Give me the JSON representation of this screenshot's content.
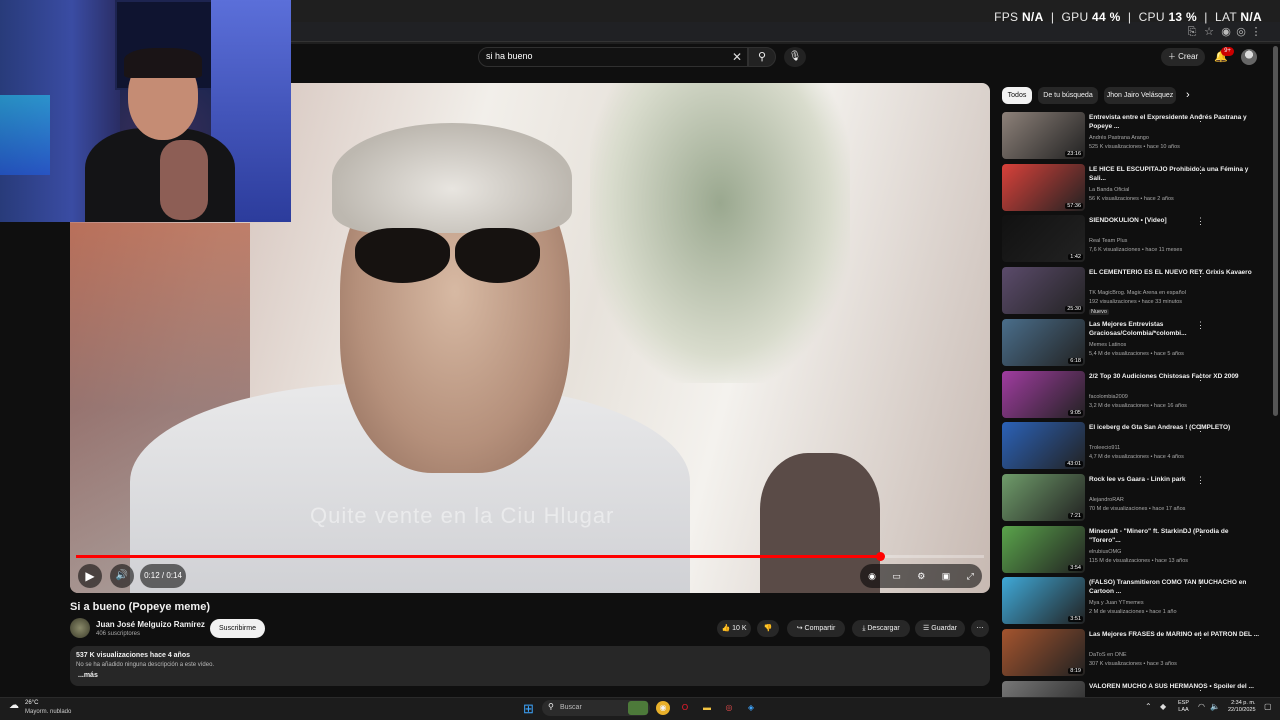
{
  "overlay": {
    "fps_label": "FPS",
    "fps_value": "N/A",
    "gpu_label": "GPU",
    "gpu_value": "44 %",
    "cpu_label": "CPU",
    "cpu_value": "13 %",
    "lat_label": "LAT",
    "lat_value": "N/A"
  },
  "header": {
    "search_value": "si ha bueno",
    "create_label": "Crear",
    "notifications_badge": "9+"
  },
  "player": {
    "subtitle_ghost": "Quite vente en la Ciu Hlugar",
    "time": "0:12 / 0:14",
    "progress": 0.885
  },
  "video": {
    "title": "Si a bueno (Popeye meme)",
    "channel": "Juan José Melguizo Ramírez",
    "subscribers": "406 suscriptores",
    "subscribe_label": "Suscribirme",
    "likes": "10 K",
    "share_label": "Compartir",
    "download_label": "Descargar",
    "save_label": "Guardar",
    "views_line": "537 K visualizaciones  hace 4 años",
    "description": "No se ha añadido ninguna descripción a este vídeo.",
    "more_label": "...más"
  },
  "chips": [
    "Todos",
    "De tu búsqueda",
    "Jhon Jairo Velásquez"
  ],
  "recommendations": [
    {
      "title": "Entrevista entre el Expresidente Andrés Pastrana y Popeye ...",
      "channel": "Andrés Pastrana Arango",
      "meta": "525 K visualizaciones • hace 10 años",
      "duration": "23:16",
      "thumb": "#8d8179"
    },
    {
      "title": "LE HICE EL ESCUPITAJO Prohibido a una Fémina y Sali...",
      "channel": "La Banda Oficial",
      "meta": "56 K visualizaciones • hace 2 años",
      "duration": "57:36",
      "thumb": "#d9413a"
    },
    {
      "title": "SIENDOKULION • [Video]",
      "channel": "Real Team Plus",
      "meta": "7,6 K visualizaciones • hace 11 meses",
      "duration": "1:42",
      "thumb": "#111111"
    },
    {
      "title": "EL CEMENTERIO ES EL NUEVO REY. Grixis Kavaero",
      "channel": "TK MagicBrog. Magic Arena en español",
      "meta": "192 visualizaciones • hace 33 minutos",
      "duration": "25:30",
      "thumb": "#5b4b6b",
      "nuevo": "Nuevo"
    },
    {
      "title": "Las Mejores Entrevistas Graciosas/Colombia/*colombi...",
      "channel": "Memes Latinos",
      "meta": "5,4 M de visualizaciones • hace 5 años",
      "duration": "6:18",
      "thumb": "#4a6e8b"
    },
    {
      "title": "2/2 Top 30 Audiciones Chistosas Factor XD 2009",
      "channel": "facolombia2009",
      "meta": "3,2 M de visualizaciones • hace 16 años",
      "duration": "9:05",
      "thumb": "#a03ca0"
    },
    {
      "title": "El iceberg de Gta San Andreas ! (COMPLETO)",
      "channel": "Troleecio911",
      "meta": "4,7 M de visualizaciones • hace 4 años",
      "duration": "43:01",
      "thumb": "#2b62b8"
    },
    {
      "title": "Rock lee vs Gaara - Linkin park",
      "channel": "AlejandroRAR",
      "meta": "70 M de visualizaciones • hace 17 años",
      "duration": "7:21",
      "thumb": "#6f9c6a"
    },
    {
      "title": "Minecraft - \"Minero\" ft. StarkinDJ (Parodia de \"Torero\"...",
      "channel": "elrubiusOMG",
      "meta": "115 M de visualizaciones • hace 13 años",
      "duration": "3:54",
      "thumb": "#5aa44b"
    },
    {
      "title": "(FALSO) Transmitieron COMO TAN MUCHACHO en Cartoon ...",
      "channel": "Mya y Juan YTmemes",
      "meta": "2 M de visualizaciones • hace 1 año",
      "duration": "3:51",
      "thumb": "#3fa9d8"
    },
    {
      "title": "Las Mejores FRASES de MARINO en el PATRON DEL ...",
      "channel": "DaToS en ONE",
      "meta": "307 K visualizaciones • hace 3 años",
      "duration": "8:19",
      "thumb": "#a4542e"
    },
    {
      "title": "VALOREN MUCHO A SUS HERMANOS • Spoiler del ...",
      "channel": "",
      "meta": "",
      "duration": "",
      "thumb": "#777777"
    }
  ],
  "taskbar": {
    "temperature": "26°C",
    "weather": "Mayorm. nublado",
    "search_placeholder": "Buscar",
    "lang_top": "ESP",
    "lang_bottom": "LAA",
    "time": "2:34 p. m.",
    "date": "22/10/2025"
  }
}
